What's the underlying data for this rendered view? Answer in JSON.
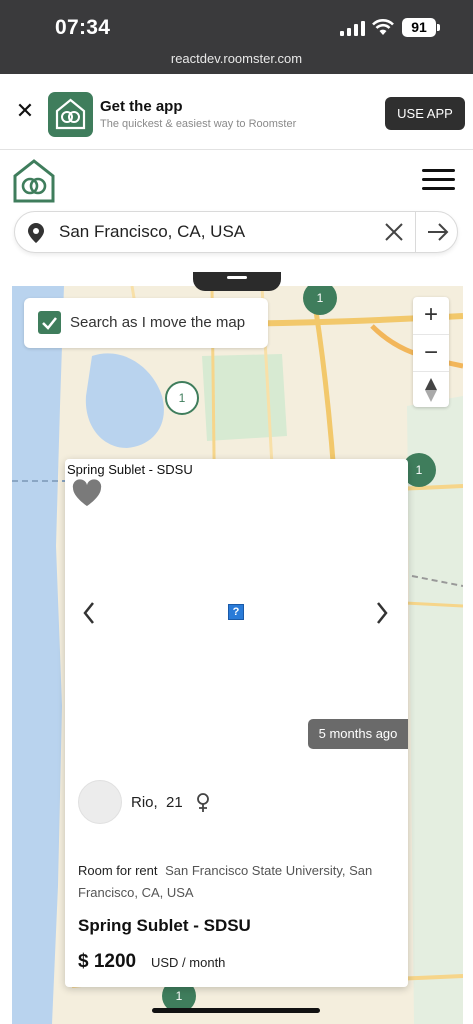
{
  "status_bar": {
    "time": "07:34",
    "battery": "91"
  },
  "browser": {
    "url": "reactdev.roomster.com"
  },
  "banner": {
    "title": "Get the app",
    "subtitle": "The quickest & easiest way to Roomster",
    "button": "USE APP"
  },
  "search": {
    "value": "San Francisco, CA, USA"
  },
  "map": {
    "search_as_move_label": "Search as I move the map",
    "search_as_move_checked": true,
    "clusters": [
      "1",
      "1",
      "1",
      "1"
    ]
  },
  "listing": {
    "top_title": "Spring  Sublet - SDSU",
    "posted_ago": "5 months ago",
    "user_name": "Rio,",
    "user_age": "21",
    "type": "Room for rent",
    "location": "San Francisco State University, San Francisco, CA, USA",
    "title": "Spring Sublet - SDSU",
    "price": "$ 1200",
    "period": "USD / month"
  },
  "colors": {
    "brand_green": "#3f7d5c",
    "dark": "#2f2f2f"
  }
}
